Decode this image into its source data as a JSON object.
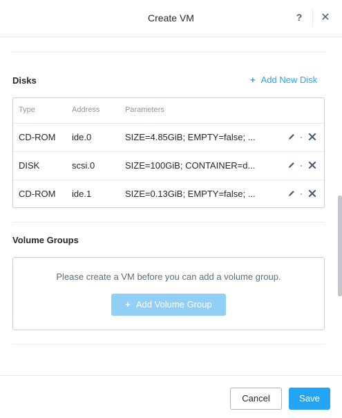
{
  "header": {
    "title": "Create VM",
    "help_icon": "?",
    "close_icon": "✕"
  },
  "disks": {
    "title": "Disks",
    "add_label": "Add New Disk",
    "add_icon": "+",
    "columns": [
      "Type",
      "Address",
      "Parameters"
    ],
    "rows": [
      {
        "type": "CD-ROM",
        "address": "ide.0",
        "parameters": "SIZE=4.85GiB; EMPTY=false; ..."
      },
      {
        "type": "DISK",
        "address": "scsi.0",
        "parameters": "SIZE=100GiB; CONTAINER=d..."
      },
      {
        "type": "CD-ROM",
        "address": "ide.1",
        "parameters": "SIZE=0.13GiB; EMPTY=false; ..."
      }
    ],
    "row_action_icons": [
      "pencil-icon",
      "close-icon"
    ]
  },
  "volume_groups": {
    "title": "Volume Groups",
    "message": "Please create a VM before you can add a volume group.",
    "add_label": "Add Volume Group",
    "add_icon": "+"
  },
  "footer": {
    "cancel_label": "Cancel",
    "save_label": "Save"
  },
  "colors": {
    "accent": "#22a5f7",
    "accent_disabled": "#91cff7",
    "border": "#c9ced4",
    "text": "#22272e",
    "muted": "#8e98a2"
  }
}
